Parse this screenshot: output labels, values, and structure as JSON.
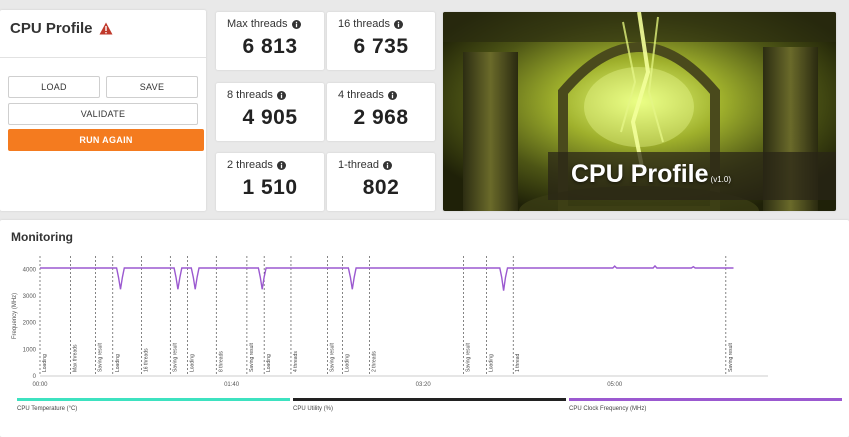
{
  "profile": {
    "title": "CPU Profile",
    "warning_icon": "warning-triangle-icon",
    "buttons": {
      "load": "LOAD",
      "save": "SAVE",
      "validate": "VALIDATE",
      "run_again": "RUN AGAIN"
    },
    "accent": "#f47b1f"
  },
  "scores": [
    {
      "label": "Max threads",
      "value": "6 813"
    },
    {
      "label": "16 threads",
      "value": "6 735"
    },
    {
      "label": "8 threads",
      "value": "4 905"
    },
    {
      "label": "4 threads",
      "value": "2 968"
    },
    {
      "label": "2 threads",
      "value": "1 510"
    },
    {
      "label": "1-thread",
      "value": "802"
    }
  ],
  "hero": {
    "title": "CPU Profile",
    "version": "(v1.0)"
  },
  "monitoring": {
    "title": "Monitoring",
    "chart_data": {
      "type": "line",
      "ylabel": "Frequency (MHz)",
      "ylim": [
        0,
        4500
      ],
      "yticks": [
        0,
        1000,
        2000,
        3000,
        4000
      ],
      "xticks": [
        "00:00",
        "01:40",
        "03:20",
        "05:00"
      ],
      "xlim": [
        0,
        380
      ],
      "series": [
        {
          "name": "CPU Clock Frequency (MHz)",
          "color": "#9b59d0",
          "x": [
            0,
            40,
            41,
            42,
            43,
            44,
            70,
            71,
            72,
            73,
            74,
            79,
            80,
            81,
            82,
            83,
            114,
            115,
            116,
            117,
            118,
            161,
            162,
            163,
            164,
            165,
            240,
            241,
            242,
            243,
            244,
            299,
            300,
            301,
            320,
            321,
            322,
            340,
            341,
            342,
            362
          ],
          "values": [
            4050,
            4050,
            3700,
            3250,
            3700,
            4050,
            4050,
            3700,
            3250,
            3700,
            4050,
            4050,
            3700,
            3250,
            3700,
            4050,
            4050,
            3700,
            3250,
            3700,
            4050,
            4050,
            3700,
            3250,
            3700,
            4050,
            4050,
            3700,
            3200,
            3700,
            4050,
            4050,
            4120,
            4050,
            4050,
            4130,
            4050,
            4050,
            4100,
            4050,
            4050
          ]
        }
      ],
      "markers": [
        {
          "t": 0,
          "label": "Loading"
        },
        {
          "t": 16,
          "label": "Max threads"
        },
        {
          "t": 29,
          "label": "Saving result"
        },
        {
          "t": 38,
          "label": "Loading"
        },
        {
          "t": 53,
          "label": "16 threads"
        },
        {
          "t": 68,
          "label": "Saving result"
        },
        {
          "t": 77,
          "label": "Loading"
        },
        {
          "t": 92,
          "label": "8 threads"
        },
        {
          "t": 108,
          "label": "Saving result"
        },
        {
          "t": 117,
          "label": "Loading"
        },
        {
          "t": 131,
          "label": "4 threads"
        },
        {
          "t": 150,
          "label": "Saving result"
        },
        {
          "t": 158,
          "label": "Loading"
        },
        {
          "t": 172,
          "label": "2 threads"
        },
        {
          "t": 221,
          "label": "Saving result"
        },
        {
          "t": 233,
          "label": "Loading"
        },
        {
          "t": 247,
          "label": "1 thread"
        },
        {
          "t": 358,
          "label": "Saving result"
        }
      ],
      "legend": [
        {
          "name": "CPU Temperature (°C)",
          "color": "#3de2c0"
        },
        {
          "name": "CPU Utility (%)",
          "color": "#222222"
        },
        {
          "name": "CPU Clock Frequency (MHz)",
          "color": "#9b59d0"
        }
      ]
    }
  }
}
